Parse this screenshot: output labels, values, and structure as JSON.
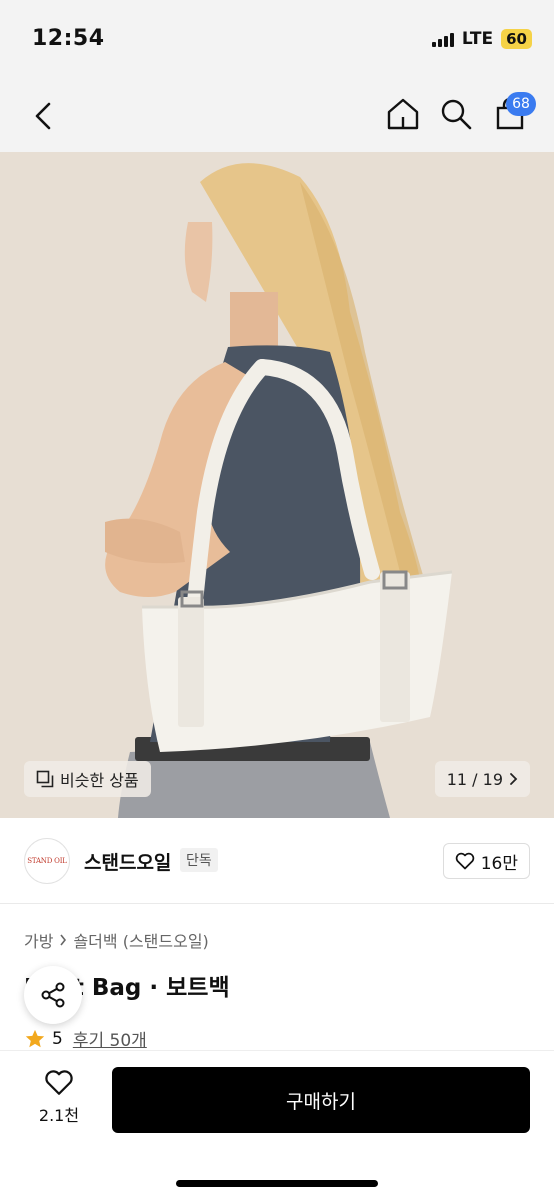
{
  "status_bar": {
    "time": "12:54",
    "network": "LTE",
    "battery": "60"
  },
  "nav": {
    "cart_count": "68",
    "back_icon": "chevron-left-icon",
    "home_icon": "home-icon",
    "search_icon": "search-icon",
    "cart_icon": "shopping-bag-icon"
  },
  "image": {
    "similar_label": "비슷한 상품",
    "pager": "11 / 19"
  },
  "brand": {
    "logo_text": "STAND OIL",
    "name": "스탠드오일",
    "tag": "단독",
    "likes": "16만"
  },
  "breadcrumb": {
    "category": "가방",
    "subcategory": "숄더백 (스탠드오일)"
  },
  "product": {
    "title": "Boat Bag · 보트백",
    "rating": "5",
    "reviews": "후기 50개"
  },
  "bottom": {
    "wish_count": "2.1천",
    "buy_label": "구매하기"
  },
  "colors": {
    "badge": "#3a7bf0",
    "star": "#f2a81d",
    "buy_button": "#000000",
    "battery": "#f5d247"
  }
}
